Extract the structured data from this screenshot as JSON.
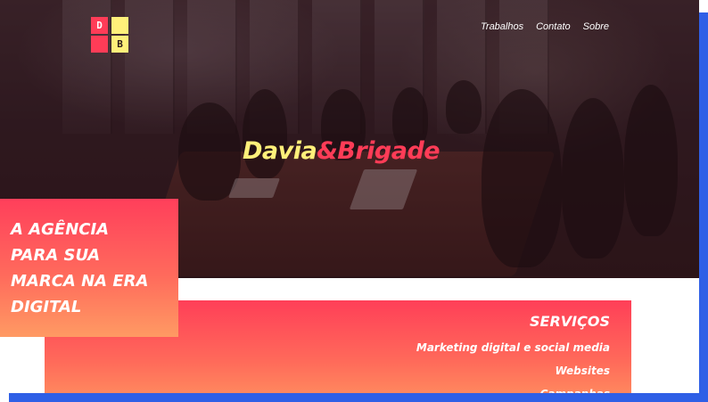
{
  "logo": {
    "tiles": [
      "D",
      "",
      "",
      "B"
    ],
    "colors": {
      "red": "#ff3c57",
      "yellow": "#fff07a"
    }
  },
  "nav": {
    "items": [
      {
        "label": "Trabalhos"
      },
      {
        "label": "Contato"
      },
      {
        "label": "Sobre"
      }
    ]
  },
  "hero": {
    "brand_part1": "Davia",
    "brand_part2": "&Brigade",
    "background_image": "meeting-room-photo"
  },
  "tagline": {
    "lines": [
      "A AGÊNCIA",
      "PARA SUA",
      "MARCA NA ERA",
      "DIGITAL"
    ]
  },
  "services": {
    "title": "SERVIÇOS",
    "items": [
      "Marketing digital e social media",
      "Websites",
      "Campanhas"
    ]
  },
  "colors": {
    "accent_red": "#ff3c57",
    "accent_yellow": "#fff07a",
    "frame_blue": "#2f5fe6"
  }
}
